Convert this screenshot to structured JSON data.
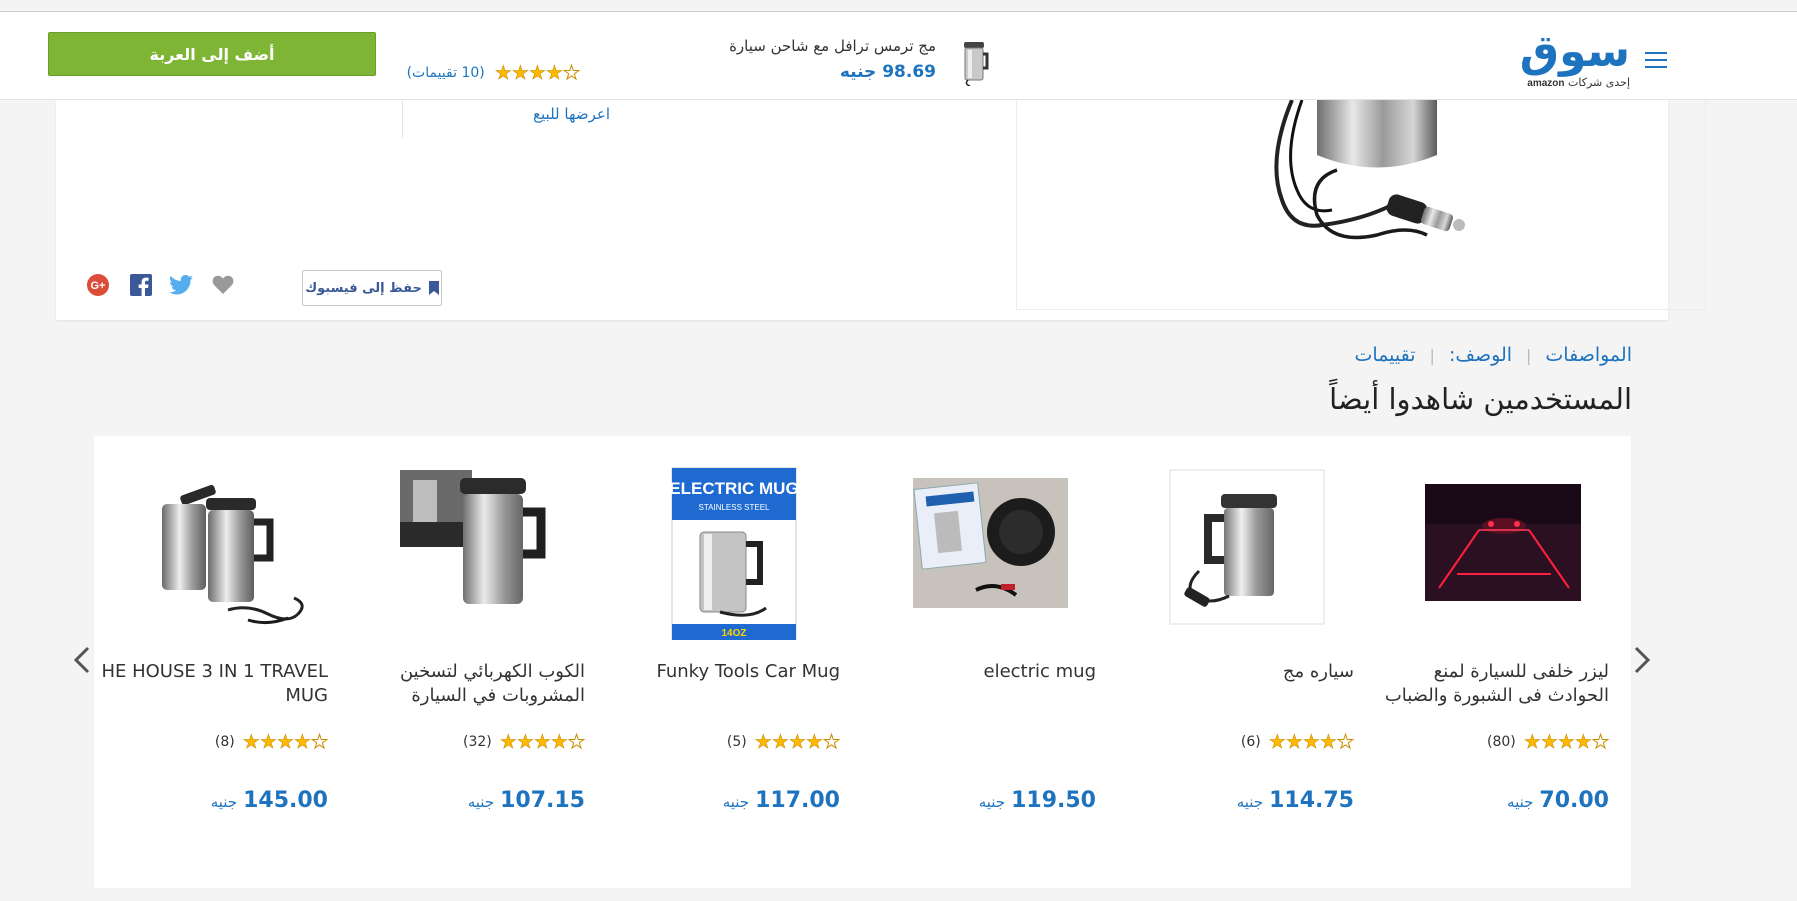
{
  "header": {
    "logo_word": "سوق",
    "logo_sub_ar": "إحدى شركات",
    "logo_sub_brand": "amazon",
    "product_title": "مج ترمس ترافل مع شاحن سيارة",
    "product_price": "98.69 جنيه",
    "rating_count": "(10 تقييمات)",
    "rating_stars": 4,
    "add_to_cart": "أضف إلى العربة"
  },
  "product": {
    "sell_link": "اعرضها للبيع",
    "save_facebook": "حفظ إلى فيسبوك"
  },
  "tabs": [
    {
      "label": "المواصفات"
    },
    {
      "label": "الوصف:"
    },
    {
      "label": "تقييمات"
    }
  ],
  "section_title": "المستخدمين شاهدوا أيضاً",
  "currency": "جنيه",
  "carousel": [
    {
      "name": "ليزر خلفى للسيارة لمنع الحوادث فى الشبورة والضباب",
      "count": "(80)",
      "stars": 4,
      "price": "70.00",
      "icon": "laser-photo"
    },
    {
      "name": "سياره مج",
      "count": "(6)",
      "stars": 4,
      "price": "114.75",
      "icon": "mug-photo"
    },
    {
      "name": "electric mug",
      "count": "",
      "stars": 0,
      "price": "119.50",
      "icon": "mug-box-photo"
    },
    {
      "name": "Funky Tools Car Mug",
      "count": "(5)",
      "stars": 4,
      "price": "117.00",
      "icon": "electric-mug-box-photo"
    },
    {
      "name": "الكوب الكهربائي لتسخين المشروبات في السيارة",
      "count": "(32)",
      "stars": 4,
      "price": "107.15",
      "icon": "mug-photo"
    },
    {
      "name": "HE HOUSE 3 IN 1 TRAVEL MUG",
      "count": "(8)",
      "stars": 4,
      "price": "145.00",
      "icon": "mug-set-photo"
    }
  ],
  "colors": {
    "accent": "#1e73be",
    "cart_button": "#7fb534",
    "star": "#ffb800"
  }
}
